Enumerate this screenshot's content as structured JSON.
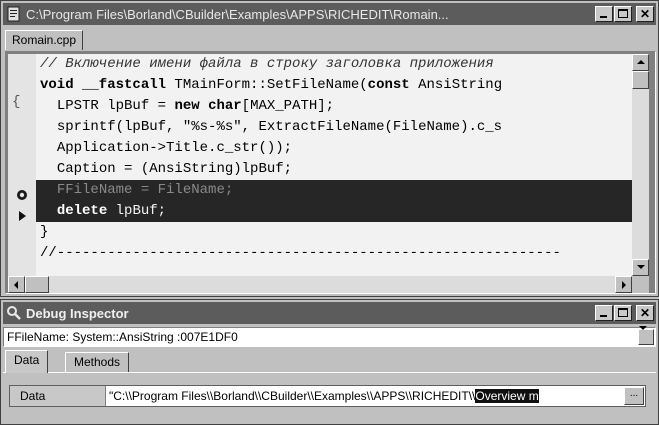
{
  "editor": {
    "title": "C:\\Program Files\\Borland\\CBuilder\\Examples\\APPS\\RICHEDIT\\Romain...",
    "tab_label": "Romain.cpp",
    "window_buttons": {
      "close": "✕"
    },
    "code": {
      "l1": "// Включение имени файла в строку заголовка приложения",
      "l2_kw1": "void __fastcall",
      "l2_rest": " TMainForm::SetFileName(",
      "l2_kw2": "const",
      "l2_tail": " AnsiString",
      "l3_fold": "{",
      "l3_a": "LPSTR lpBuf = ",
      "l3_kw1": "new",
      "l3_b": " ",
      "l3_kw2": "char",
      "l3_c": "[MAX_PATH];",
      "l4": "sprintf(lpBuf, \"%s-%s\", ExtractFileName(FileName).c_s",
      "l5": "Application->Title.c_str());",
      "l6": "Caption = (AnsiString)lpBuf;",
      "l7": "FFileName = FileName;",
      "l8_kw": "delete",
      "l8_rest": " lpBuf;",
      "l9_fold": "}",
      "l10": "//------------------------------------------------------------"
    }
  },
  "inspector": {
    "title": "Debug Inspector",
    "window_buttons": {
      "close": "✕"
    },
    "combo_value": "FFileName: System::AnsiString :007E1DF0",
    "tabs": [
      "Data",
      "Methods"
    ],
    "data_row": {
      "label": "Data",
      "value_plain": "\"C:\\\\Program Files\\\\Borland\\\\CBuilder\\\\Examples\\\\APPS\\\\RICHEDIT\\\\",
      "value_selected": "Overview m",
      "button": "..."
    }
  },
  "colors": {
    "title_bar": "#5c5c5c",
    "execution_highlight": "#262626",
    "editor_bg": "#f2f2f2",
    "window_bg": "#c0c0c0"
  },
  "icons": {
    "editor_window": "borland-editor-icon",
    "inspector_window": "inspector-icon",
    "breakpoint": "breakpoint-icon",
    "execution_point": "execution-arrow-icon"
  }
}
